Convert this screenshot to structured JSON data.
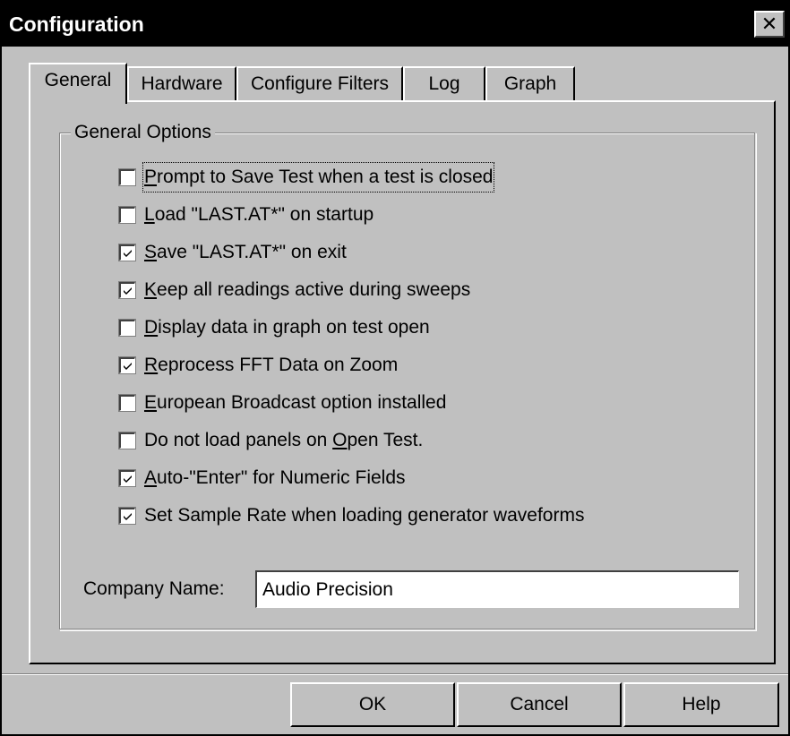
{
  "window": {
    "title": "Configuration",
    "close_glyph": "✕"
  },
  "tabs": [
    {
      "label": "General",
      "active": true
    },
    {
      "label": "Hardware",
      "active": false
    },
    {
      "label": "Configure Filters",
      "active": false
    },
    {
      "label": "Log",
      "active": false
    },
    {
      "label": "Graph",
      "active": false
    }
  ],
  "group": {
    "title": "General Options",
    "options": [
      {
        "pre": "",
        "ul": "P",
        "post": "rompt to Save Test  when a test is closed",
        "checked": false
      },
      {
        "pre": "",
        "ul": "L",
        "post": "oad \"LAST.AT*\" on startup",
        "checked": false
      },
      {
        "pre": "",
        "ul": "S",
        "post": "ave \"LAST.AT*\" on exit",
        "checked": true
      },
      {
        "pre": "",
        "ul": "K",
        "post": "eep all readings active during sweeps",
        "checked": true
      },
      {
        "pre": "",
        "ul": "D",
        "post": "isplay data in graph on test open",
        "checked": false
      },
      {
        "pre": "",
        "ul": "R",
        "post": "eprocess FFT Data on Zoom",
        "checked": true
      },
      {
        "pre": "",
        "ul": "E",
        "post": "uropean Broadcast option installed",
        "checked": false
      },
      {
        "pre": "Do not load panels on ",
        "ul": "O",
        "post": "pen Test.",
        "checked": false
      },
      {
        "pre": "",
        "ul": "A",
        "post": "uto-\"Enter\" for Numeric Fields",
        "checked": true
      },
      {
        "pre": "Set Sample Rate when loading generator waveforms",
        "ul": "",
        "post": "",
        "checked": true
      }
    ]
  },
  "company": {
    "label": "Company Name:",
    "value": "Audio Precision"
  },
  "buttons": {
    "ok": "OK",
    "cancel": "Cancel",
    "help": "Help"
  }
}
